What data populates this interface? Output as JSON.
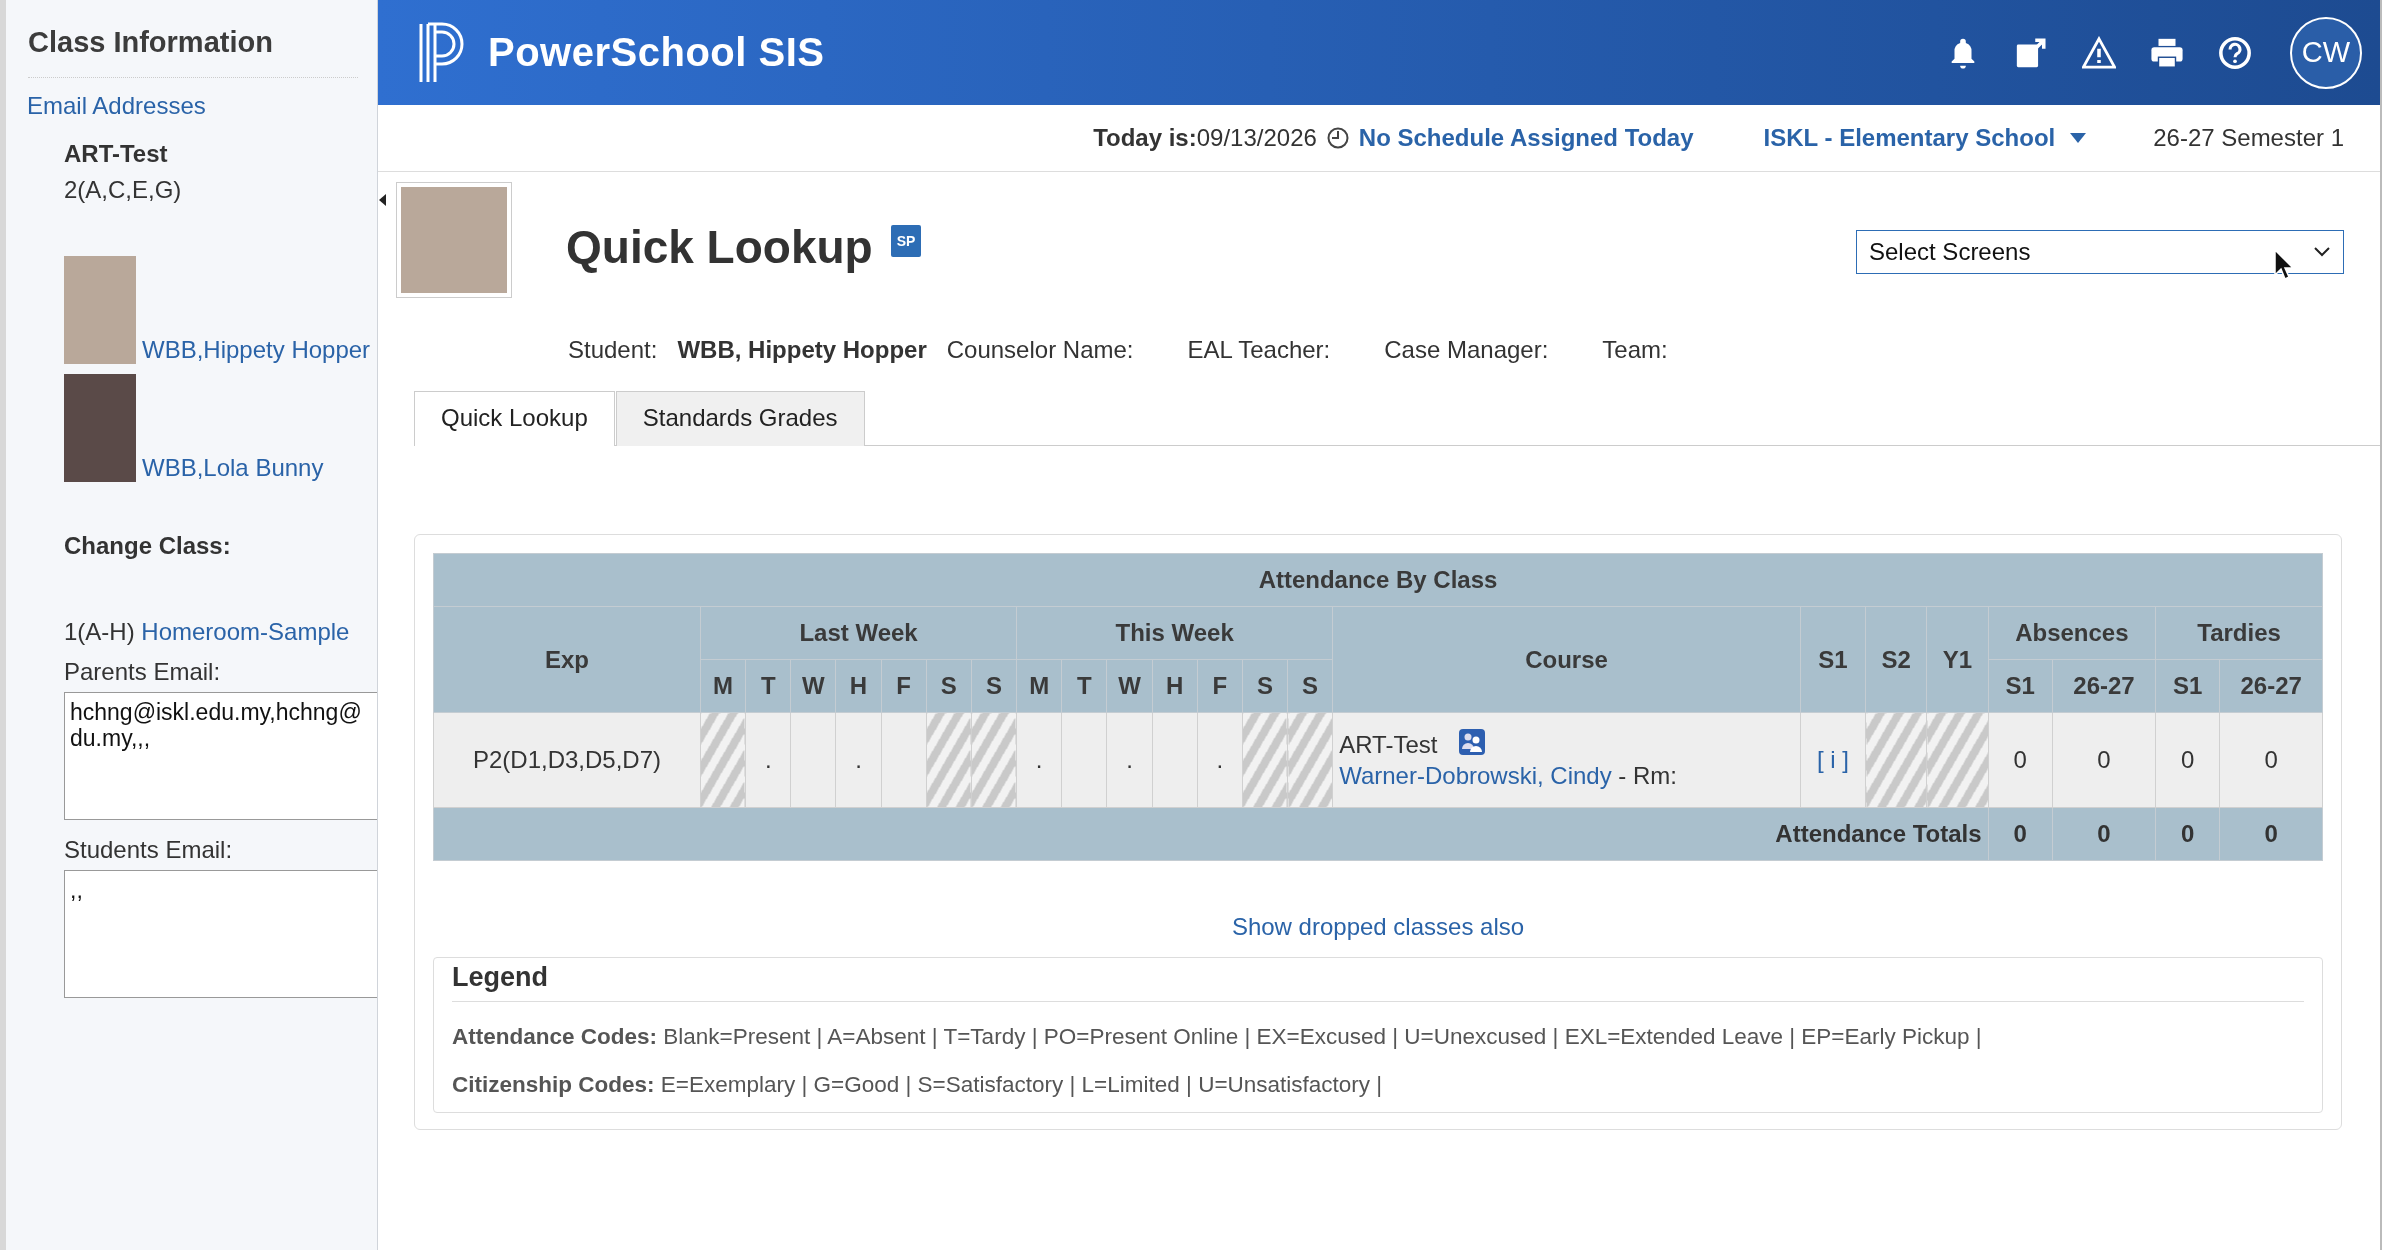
{
  "sidebar": {
    "title": "Class Information",
    "email_link": "Email Addresses",
    "class_name": "ART-Test",
    "class_period": "2(A,C,E,G)",
    "students": [
      {
        "name": "WBB,Hippety Hopper"
      },
      {
        "name": "WBB,Lola Bunny"
      }
    ],
    "change_class_label": "Change Class:",
    "change_class": {
      "period": "1(A-H)",
      "link": "Homeroom-Sample"
    },
    "parents_email": {
      "label": "Parents Email:",
      "lines": [
        "hchng@iskl.edu.my,hchng@",
        "du.my,,,"
      ]
    },
    "students_email": {
      "label": "Students Email:",
      "lines": [
        ",,"
      ]
    }
  },
  "header": {
    "brand": "PowerSchool SIS",
    "avatar": "CW"
  },
  "subheader": {
    "today": "**Today is:**09/13/2026",
    "schedule_link": "No Schedule Assigned Today",
    "school": "ISKL - Elementary School",
    "term": "26-27 Semester 1"
  },
  "page": {
    "title": "Quick Lookup",
    "badge": "SP",
    "select": {
      "value": "Select Screens"
    },
    "student_label": "Student:",
    "student_name": "WBB, Hippety Hopper",
    "info_labels": [
      "Counselor Name:",
      "EAL Teacher:",
      "Case Manager:",
      "Team:"
    ]
  },
  "tabs": [
    {
      "label": "Quick Lookup",
      "selected": true
    },
    {
      "label": "Standards Grades",
      "selected": false
    }
  ],
  "table": {
    "title": "Attendance By Class",
    "exp": "Exp",
    "last_week": "Last Week",
    "this_week": "This Week",
    "course": "Course",
    "terms": [
      "S1",
      "S2",
      "Y1"
    ],
    "absences": "Absences",
    "tardies": "Tardies",
    "last_week_days": [
      "M",
      "T",
      "W",
      "H",
      "F",
      "S",
      "S"
    ],
    "this_week_days": [
      "M",
      "T",
      "W",
      "H",
      "F",
      "S",
      "S"
    ],
    "absences_sub": [
      "S1",
      "26-27"
    ],
    "tardies_sub": [
      "S1",
      "26-27"
    ],
    "rows": [
      {
        "exp": "P2(D1,D3,D5,D7)",
        "last_week": [
          {
            "hatched": true
          },
          {
            "text": ".",
            "hatched": false
          },
          {
            "hatched": false
          },
          {
            "text": ".",
            "hatched": false
          },
          {
            "hatched": false
          },
          {
            "hatched": true
          },
          {
            "hatched": true
          }
        ],
        "this_week": [
          {
            "text": ".",
            "hatched": false
          },
          {
            "hatched": false
          },
          {
            "text": ".",
            "hatched": false
          },
          {
            "hatched": false
          },
          {
            "text": ".",
            "hatched": false
          },
          {
            "hatched": true
          },
          {
            "hatched": true
          }
        ],
        "course": "ART-Test",
        "teacher": "Warner-Dobrowski, Cindy",
        "room": "- Rm:",
        "terms": [
          {
            "text": "[ i ]",
            "hatched": false
          },
          {
            "hatched": true
          },
          {
            "hatched": true
          }
        ],
        "absences": [
          "0",
          "0"
        ],
        "tardies": [
          "0",
          "0"
        ]
      }
    ],
    "totals": {
      "label": "Attendance Totals",
      "values": [
        "0",
        "0",
        "0",
        "0"
      ]
    }
  },
  "dropped_link": "Show dropped classes also",
  "legend": {
    "title": "Legend",
    "lines": [
      "**Attendance Codes:** Blank=Present | A=Absent | T=Tardy | PO=Present Online | EX=Excused | U=Unexcused | EXL=Extended Leave | EP=Early Pickup |",
      "**Citizenship Codes:** E=Exemplary | G=Good | S=Satisfactory | L=Limited | U=Unsatisfactory |"
    ]
  }
}
